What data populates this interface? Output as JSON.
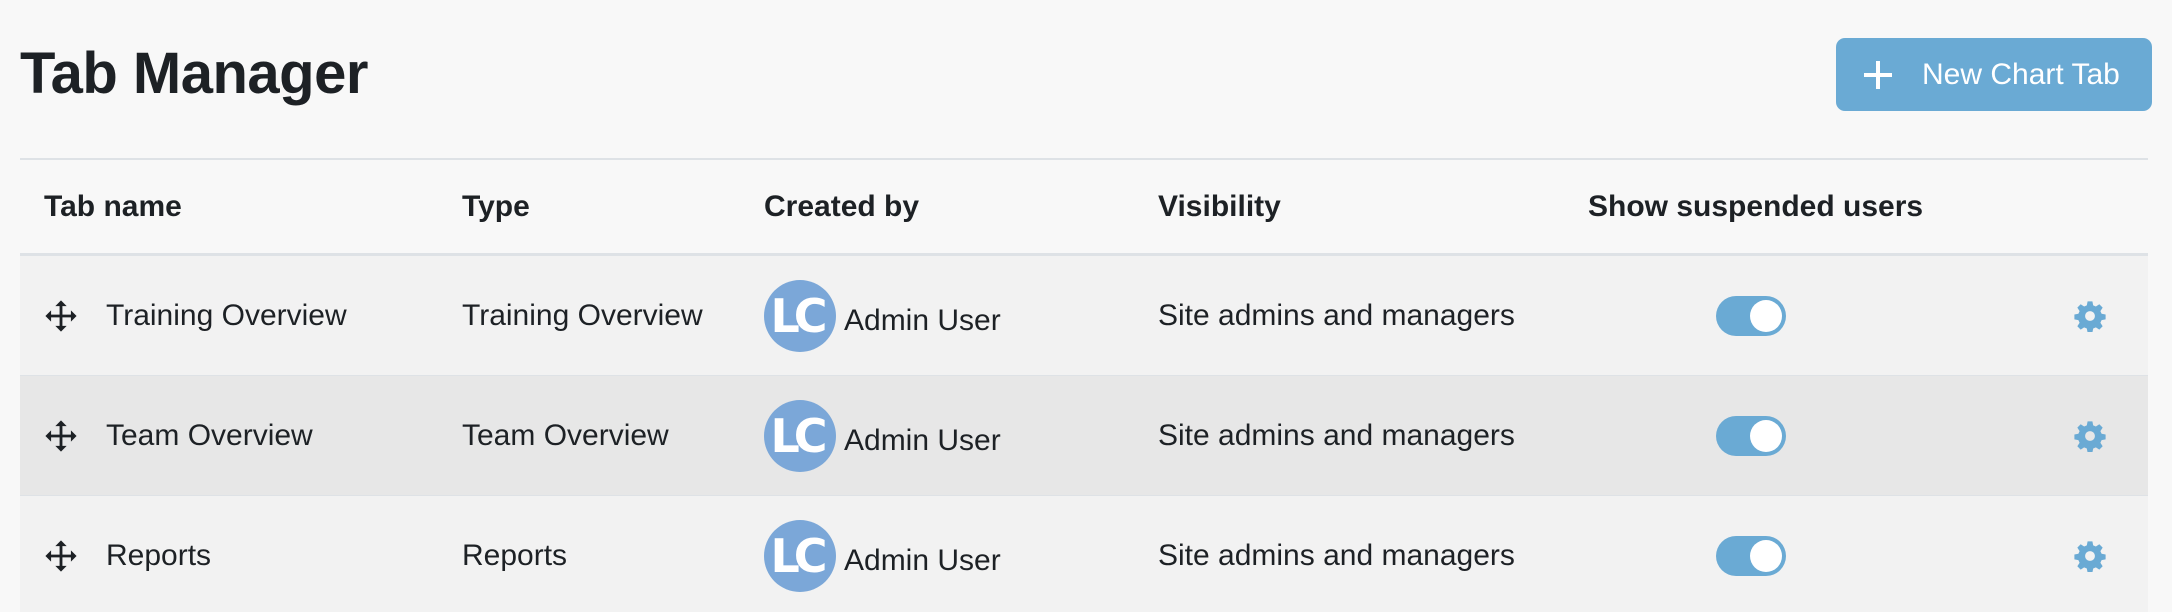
{
  "header": {
    "title": "Tab Manager",
    "new_tab_label": "New Chart Tab",
    "new_tab_icon": "plus-icon"
  },
  "table": {
    "columns": {
      "name": "Tab name",
      "type": "Type",
      "created_by": "Created by",
      "visibility": "Visibility",
      "show_suspended": "Show suspended users"
    },
    "rows": [
      {
        "name": "Training Overview",
        "type": "Training Overview",
        "avatar_initials": "LC",
        "created_by": "Admin User",
        "visibility": "Site admins and managers",
        "show_suspended": true
      },
      {
        "name": "Team Overview",
        "type": "Team Overview",
        "avatar_initials": "LC",
        "created_by": "Admin User",
        "visibility": "Site admins and managers",
        "show_suspended": true
      },
      {
        "name": "Reports",
        "type": "Reports",
        "avatar_initials": "LC",
        "created_by": "Admin User",
        "visibility": "Site admins and managers",
        "show_suspended": true
      }
    ]
  },
  "colors": {
    "accent": "#6aaad4",
    "avatar": "#7ba7d8",
    "title_text": "#1d2125",
    "row_stripe": "#e7e7e7"
  }
}
